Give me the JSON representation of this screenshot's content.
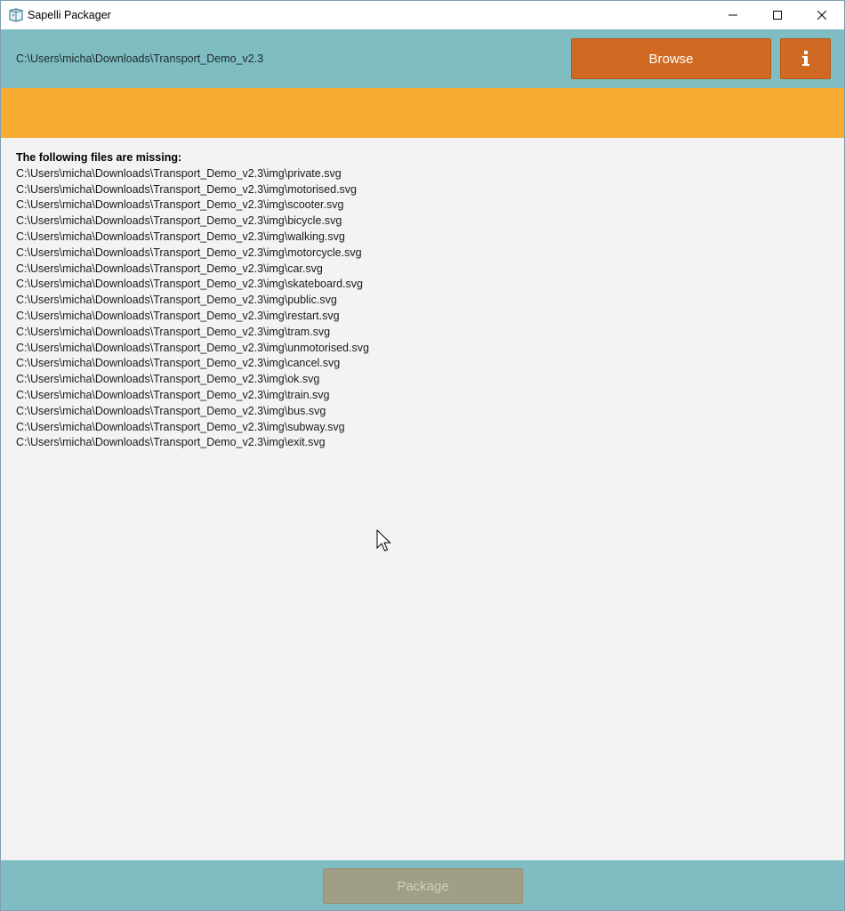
{
  "window": {
    "title": "Sapelli Packager",
    "icon": "sapelli-icon",
    "controls": [
      "minimize-icon",
      "maximize-icon",
      "close-icon"
    ]
  },
  "header": {
    "path": "C:\\Users\\micha\\Downloads\\Transport_Demo_v2.3",
    "browse_label": "Browse",
    "info_icon": "info-icon"
  },
  "content": {
    "heading": "The following files are missing:",
    "missing_files": [
      "C:\\Users\\micha\\Downloads\\Transport_Demo_v2.3\\img\\private.svg",
      "C:\\Users\\micha\\Downloads\\Transport_Demo_v2.3\\img\\motorised.svg",
      "C:\\Users\\micha\\Downloads\\Transport_Demo_v2.3\\img\\scooter.svg",
      "C:\\Users\\micha\\Downloads\\Transport_Demo_v2.3\\img\\bicycle.svg",
      "C:\\Users\\micha\\Downloads\\Transport_Demo_v2.3\\img\\walking.svg",
      "C:\\Users\\micha\\Downloads\\Transport_Demo_v2.3\\img\\motorcycle.svg",
      "C:\\Users\\micha\\Downloads\\Transport_Demo_v2.3\\img\\car.svg",
      "C:\\Users\\micha\\Downloads\\Transport_Demo_v2.3\\img\\skateboard.svg",
      "C:\\Users\\micha\\Downloads\\Transport_Demo_v2.3\\img\\public.svg",
      "C:\\Users\\micha\\Downloads\\Transport_Demo_v2.3\\img\\restart.svg",
      "C:\\Users\\micha\\Downloads\\Transport_Demo_v2.3\\img\\tram.svg",
      "C:\\Users\\micha\\Downloads\\Transport_Demo_v2.3\\img\\unmotorised.svg",
      "C:\\Users\\micha\\Downloads\\Transport_Demo_v2.3\\img\\cancel.svg",
      "C:\\Users\\micha\\Downloads\\Transport_Demo_v2.3\\img\\ok.svg",
      "C:\\Users\\micha\\Downloads\\Transport_Demo_v2.3\\img\\train.svg",
      "C:\\Users\\micha\\Downloads\\Transport_Demo_v2.3\\img\\bus.svg",
      "C:\\Users\\micha\\Downloads\\Transport_Demo_v2.3\\img\\subway.svg",
      "C:\\Users\\micha\\Downloads\\Transport_Demo_v2.3\\img\\exit.svg"
    ]
  },
  "footer": {
    "package_label": "Package"
  },
  "colors": {
    "header_bg": "#7fbdc2",
    "accent_button": "#d06a22",
    "band": "#f6ac33",
    "content_bg": "#f3f3f3",
    "disabled_button": "#a19e86"
  }
}
